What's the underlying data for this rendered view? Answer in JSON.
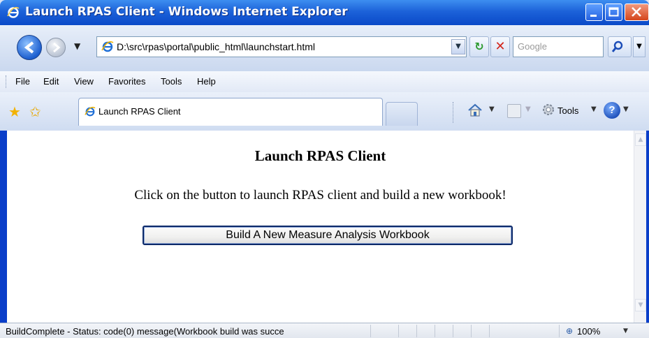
{
  "window": {
    "title": "Launch RPAS Client - Windows Internet Explorer"
  },
  "addressbar": {
    "url": "D:\\src\\rpas\\portal\\public_html\\launchstart.html",
    "search_placeholder": "Google"
  },
  "menu": {
    "items": [
      "File",
      "Edit",
      "View",
      "Favorites",
      "Tools",
      "Help"
    ]
  },
  "tabs": {
    "active_label": "Launch RPAS Client"
  },
  "toolbar": {
    "tools_label": "Tools",
    "help_glyph": "?"
  },
  "page": {
    "heading": "Launch RPAS Client",
    "text": "Click on the button to launch RPAS client and build a new workbook!",
    "button_label": "Build A New Measure Analysis Workbook"
  },
  "statusbar": {
    "text": "BuildComplete - Status: code(0) message(Workbook build was succe",
    "zoom": "100%"
  },
  "colors": {
    "titlebar": "#1c62d9",
    "frame": "#0a3ec9",
    "button_border": "#0d2a69"
  },
  "icons": [
    "ie-logo-icon",
    "back-icon",
    "forward-icon",
    "refresh-icon",
    "stop-icon",
    "search-icon",
    "favorites-star-icon",
    "add-favorites-icon",
    "home-icon",
    "feeds-icon",
    "gear-icon",
    "help-icon",
    "zoom-icon"
  ]
}
